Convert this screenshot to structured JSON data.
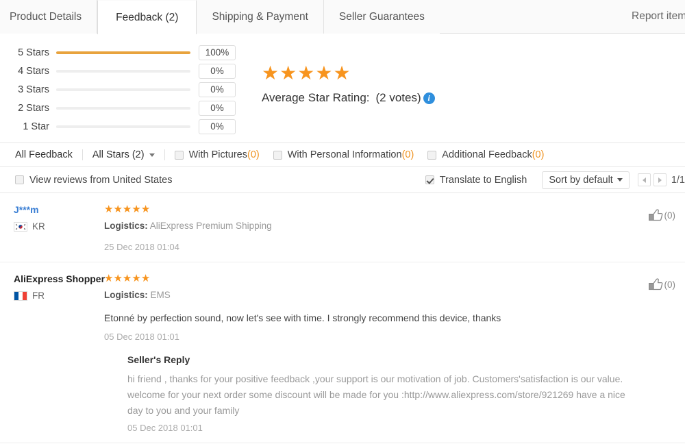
{
  "tabs": [
    {
      "label": "Product Details",
      "active": false
    },
    {
      "label": "Feedback (2)",
      "active": true
    },
    {
      "label": "Shipping & Payment",
      "active": false
    },
    {
      "label": "Seller Guarantees",
      "active": false
    }
  ],
  "report_label": "Report item",
  "rating_summary": {
    "bars": [
      {
        "label": "5 Stars",
        "percent": "100%",
        "fill": 100
      },
      {
        "label": "4 Stars",
        "percent": "0%",
        "fill": 0
      },
      {
        "label": "3 Stars",
        "percent": "0%",
        "fill": 0
      },
      {
        "label": "2 Stars",
        "percent": "0%",
        "fill": 0
      },
      {
        "label": "1 Star",
        "percent": "0%",
        "fill": 0
      }
    ],
    "average_stars": 5,
    "average_label": "Average Star Rating:",
    "votes_label": "(2 votes)",
    "info_glyph": "i"
  },
  "filters": {
    "all_feedback": "All Feedback",
    "stars_select": "All Stars (2)",
    "checkboxes": [
      {
        "label": "With Pictures ",
        "count": "(0)",
        "checked": false
      },
      {
        "label": "With Personal Information",
        "count": "(0)",
        "checked": false
      },
      {
        "label": "Additional Feedback ",
        "count": "(0)",
        "checked": false
      }
    ]
  },
  "filters2": {
    "view_reviews": "View reviews from United States",
    "view_reviews_checked": false,
    "translate": "Translate to English",
    "translate_checked": true,
    "sort_label": "Sort by default",
    "page_indicator": "1/1"
  },
  "reviews": [
    {
      "name": "J***m",
      "name_is_link": true,
      "country_code": "KR",
      "flag": "kr",
      "stars": 5,
      "logistics_label": "Logistics:",
      "logistics_value": "AliExpress Premium Shipping",
      "text": "",
      "date": "25 Dec 2018 01:04",
      "helpful_count": "(0)",
      "reply": null
    },
    {
      "name": "AliExpress Shopper",
      "name_is_link": false,
      "country_code": "FR",
      "flag": "fr",
      "stars": 5,
      "logistics_label": "Logistics:",
      "logistics_value": "EMS",
      "text": "Etonné by perfection sound, now let's see with time. I strongly recommend this device, thanks",
      "date": "05 Dec 2018 01:01",
      "helpful_count": "(0)",
      "reply": {
        "title": "Seller's Reply",
        "text": "hi friend , thanks for your positive feedback ,your support is our motivation of job. Customers'satisfaction is our value. welcome for your next order some discount will be made for you :http://www.aliexpress.com/store/921269 have a nice day to you and your family",
        "date": "05 Dec 2018 01:01"
      }
    }
  ],
  "colors": {
    "star": "#f7941e",
    "bar": "#e8a33d",
    "link": "#3b7fd4",
    "info": "#2f8fdd",
    "orange_count": "#f0921e"
  }
}
